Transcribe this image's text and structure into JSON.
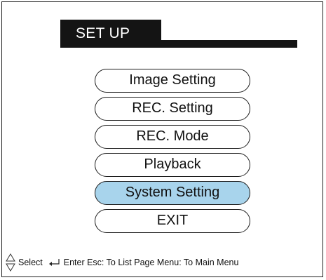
{
  "header": {
    "title": "SET UP"
  },
  "menu": {
    "items": [
      {
        "label": "Image Setting",
        "selected": false
      },
      {
        "label": "REC. Setting",
        "selected": false
      },
      {
        "label": "REC. Mode",
        "selected": false
      },
      {
        "label": "Playback",
        "selected": false
      },
      {
        "label": "System Setting",
        "selected": true
      },
      {
        "label": "EXIT",
        "selected": false
      }
    ],
    "selected_color": "#a8d4ec"
  },
  "footer": {
    "select_icon": "up-down-arrows-icon",
    "select_label": "Select",
    "enter_icon": "enter-arrow-icon",
    "hint_text": "Enter Esc: To List Page Menu: To Main Menu"
  }
}
